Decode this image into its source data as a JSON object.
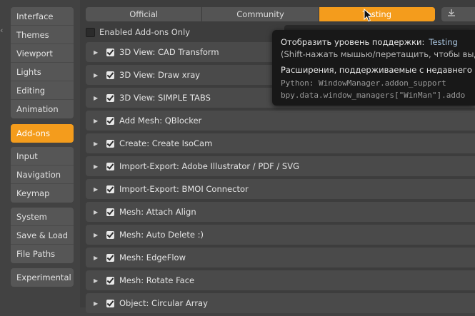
{
  "sidebar": {
    "groups": [
      [
        "Interface",
        "Themes",
        "Viewport",
        "Lights",
        "Editing",
        "Animation"
      ],
      [
        "Add-ons"
      ],
      [
        "Input",
        "Navigation",
        "Keymap"
      ],
      [
        "System",
        "Save & Load",
        "File Paths"
      ],
      [
        "Experimental"
      ]
    ],
    "active": "Add-ons"
  },
  "tabs": {
    "items": [
      "Official",
      "Community",
      "Testing"
    ],
    "active": "Testing"
  },
  "filter": {
    "enabled_only_label": "Enabled Add-ons Only"
  },
  "addons": [
    "3D View: CAD Transform",
    "3D View: Draw xray",
    "3D View: SIMPLE TABS",
    "Add Mesh: QBlocker",
    "Create: Create IsoCam",
    "Import-Export: Adobe Illustrator / PDF / SVG",
    "Import-Export: BMOI Connector",
    "Mesh: Attach Align",
    "Mesh: Auto Delete :)",
    "Mesh: EdgeFlow",
    "Mesh: Rotate Face",
    "Object: Circular Array"
  ],
  "tooltip": {
    "title": "Отобразить уровень поддержки:",
    "value": "Testing",
    "hint": "(Shift-нажать мышью/перетащить, чтобы выде",
    "description": "Расширения, поддерживаемые с недавнего в",
    "python1": "Python: WindowManager.addon_support",
    "python2": "bpy.data.window_managers[\"WinMan\"].addo"
  },
  "colors": {
    "accent": "#f49c1c",
    "background": "#3d3d3d",
    "row": "#4a4a4a",
    "tooltip_bg": "#181818"
  }
}
